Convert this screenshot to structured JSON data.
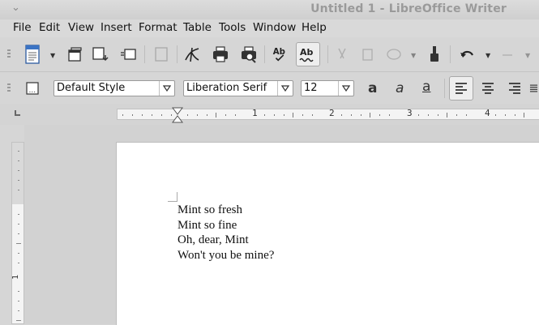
{
  "window": {
    "title": "Untitled 1 - LibreOffice Writer"
  },
  "menu": [
    {
      "label": "File",
      "accel": "F",
      "rest": "ile"
    },
    {
      "label": "Edit",
      "accel": "E",
      "rest": "dit"
    },
    {
      "label": "View",
      "accel": "V",
      "rest": "iew"
    },
    {
      "label": "Insert",
      "accel": "I",
      "rest": "nsert"
    },
    {
      "label": "Format",
      "accel": "o",
      "pre": "F",
      "rest": "rmat"
    },
    {
      "label": "Table",
      "accel": "a",
      "pre": "T",
      "rest": "ble"
    },
    {
      "label": "Tools",
      "accel": "T",
      "rest": "ools"
    },
    {
      "label": "Window",
      "accel": "W",
      "rest": "indow"
    },
    {
      "label": "Help",
      "accel": "H",
      "rest": "elp"
    }
  ],
  "formatting": {
    "paragraph_style": "Default Style",
    "font_name": "Liberation Serif",
    "font_size": "12"
  },
  "ruler": {
    "marks": [
      "1",
      "2",
      "3",
      "4"
    ]
  },
  "document": {
    "lines": [
      "Mint so fresh",
      "Mint so fine",
      "Oh, dear, Mint",
      "Won't you be mine?"
    ]
  },
  "icons": {
    "new": "new-document-icon",
    "templates": "templates-icon",
    "open": "open-icon",
    "save": "save-icon",
    "edit_file": "edit-file-icon",
    "export_pdf": "export-pdf-icon",
    "print": "print-icon",
    "print_preview": "print-preview-icon",
    "spellcheck": "spellcheck-icon",
    "autospell": "autospellcheck-icon",
    "undo": "undo-icon",
    "clone": "clone-formatting-icon"
  },
  "colors": {
    "title_text": "#9a9a9a",
    "toolbar_bg": "#d6d6d6",
    "page_bg": "#ffffff"
  }
}
